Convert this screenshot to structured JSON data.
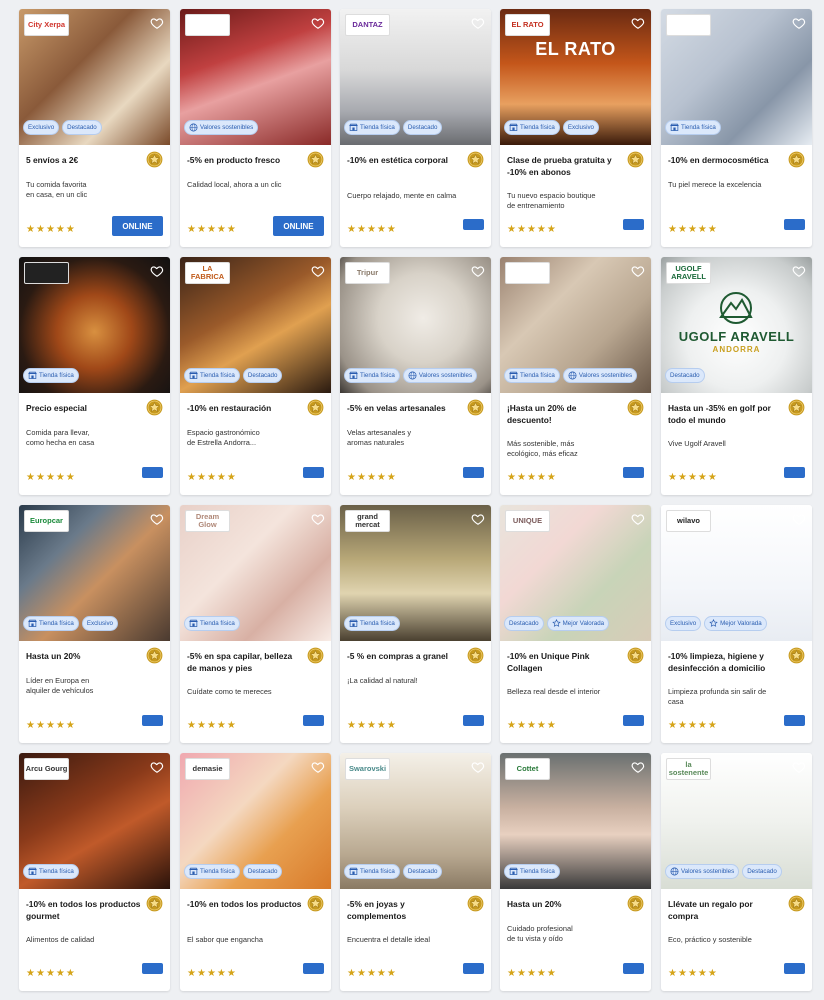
{
  "colors": {
    "accent": "#2b6cc9",
    "star": "#d5a419",
    "badge_bg": "#dbe8fb",
    "badge_text": "#2a5db0"
  },
  "cards": [
    {
      "logo": "City Xerpa",
      "badges": [
        "Exclusivo",
        "Destacado"
      ],
      "title": "5 envíos a 2€",
      "desc": "Tu comida favorita\nen casa, en un clic",
      "cta": "ONLINE"
    },
    {
      "logo": "",
      "badges": [
        "Valores sostenibles"
      ],
      "title": "-5% en producto fresco",
      "desc": "Calidad local, ahora a un clic",
      "cta": "ONLINE"
    },
    {
      "logo": "DANTAZ",
      "badges": [
        "Tienda física",
        "Destacado"
      ],
      "title": "-10% en estética corporal",
      "desc": "Cuerpo relajado, mente en calma",
      "cta": ""
    },
    {
      "logo": "EL RATO",
      "badges": [
        "Tienda física",
        "Exclusivo"
      ],
      "title": "Clase de prueba gratuita y -10% en abonos",
      "desc": "Tu nuevo espacio boutique\nde entrenamiento",
      "cta": "",
      "overlay": "EL RATO"
    },
    {
      "logo": "",
      "badges": [
        "Tienda física"
      ],
      "title": "-10% en dermocosmética",
      "desc": "Tu piel merece la excelencia",
      "cta": ""
    },
    {
      "logo": "",
      "badges": [
        "Tienda física"
      ],
      "title": "Precio especial",
      "desc": "Comida para llevar,\ncomo hecha en casa",
      "cta": ""
    },
    {
      "logo": "LA FABRICA",
      "badges": [
        "Tienda física",
        "Destacado"
      ],
      "title": "-10% en restauración",
      "desc": "Espacio gastronómico\nde Estrella Andorra...",
      "cta": ""
    },
    {
      "logo": "Tripur",
      "badges": [
        "Tienda física",
        "Valores sostenibles"
      ],
      "title": "-5% en velas artesanales",
      "desc": "Velas artesanales y\naromas naturales",
      "cta": ""
    },
    {
      "logo": "",
      "badges": [
        "Tienda física",
        "Valores sostenibles"
      ],
      "title": "¡Hasta un 20% de descuento!",
      "desc": "Más sostenible, más\necológico, más eficaz",
      "cta": ""
    },
    {
      "logo": "UGOLF ARAVELL",
      "badges": [
        "Destacado"
      ],
      "title": "Hasta un -35% en golf por todo el mundo",
      "desc": "Vive Ugolf Aravell",
      "cta": "",
      "overlay": "UGOLF ARAVELL",
      "overlay2": "ANDORRA"
    },
    {
      "logo": "Europcar",
      "badges": [
        "Tienda física",
        "Exclusivo"
      ],
      "title": "Hasta un 20%",
      "desc": "Líder en Europa en\nalquiler de vehículos",
      "cta": ""
    },
    {
      "logo": "Dream Glow",
      "badges": [
        "Tienda física"
      ],
      "title": "-5% en spa capilar, belleza de manos y pies",
      "desc": "Cuídate como te mereces",
      "cta": ""
    },
    {
      "logo": "grand mercat",
      "badges": [
        "Tienda física"
      ],
      "title": "-5 % en compras a granel",
      "desc": "¡La calidad al natural!",
      "cta": ""
    },
    {
      "logo": "UNIQUE",
      "badges": [
        "Destacado",
        "Mejor Valorada"
      ],
      "title": "-10% en Unique Pink Collagen",
      "desc": "Belleza real desde el interior",
      "cta": ""
    },
    {
      "logo": "wilavo",
      "badges": [
        "Exclusivo",
        "Mejor Valorada"
      ],
      "title": "-10% limpieza, higiene y desinfección a domicilio",
      "desc": "Limpieza profunda sin salir de casa",
      "cta": ""
    },
    {
      "logo": "Arcu Gourg",
      "badges": [
        "Tienda física"
      ],
      "title": "-10% en todos los productos gourmet",
      "desc": "Alimentos de calidad",
      "cta": ""
    },
    {
      "logo": "demasie",
      "badges": [
        "Tienda física",
        "Destacado"
      ],
      "title": "-10% en todos los productos",
      "desc": "El sabor que engancha",
      "cta": ""
    },
    {
      "logo": "Swarovski",
      "badges": [
        "Tienda física",
        "Destacado"
      ],
      "title": "-5% en joyas y complementos",
      "desc": "Encuentra el detalle ideal",
      "cta": ""
    },
    {
      "logo": "Cottet",
      "badges": [
        "Tienda física"
      ],
      "title": "Hasta un 20%",
      "desc": "Cuidado profesional\nde tu vista y oído",
      "cta": ""
    },
    {
      "logo": "la sostenente",
      "badges": [
        "Valores sostenibles",
        "Destacado"
      ],
      "title": "Llévate un regalo por compra",
      "desc": "Eco, práctico y sostenible",
      "cta": ""
    }
  ]
}
